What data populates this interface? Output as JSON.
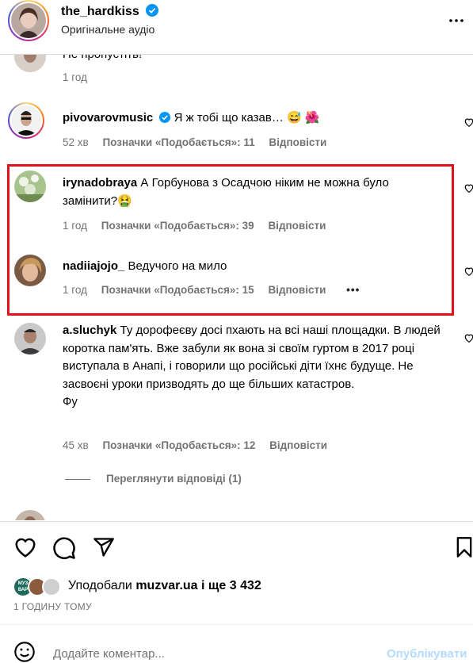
{
  "header": {
    "username": "the_hardkiss",
    "audio": "Оригінальне аудіо"
  },
  "comments": [
    {
      "user": "",
      "text": "Не пропустіть!",
      "time": "1 год",
      "likes": "",
      "reply": ""
    },
    {
      "user": "pivovarovmusic",
      "text": "Я ж тобі що казав… 😅 🌺",
      "time": "52 хв",
      "likes": "Позначки «Подобається»: 11",
      "reply": "Відповісти"
    },
    {
      "user": "irynadobraya",
      "text": "А Горбунова з Осадчою ніким не можна було замінити?🤮",
      "time": "1 год",
      "likes": "Позначки «Подобається»: 39",
      "reply": "Відповісти"
    },
    {
      "user": "nadiiajojo_",
      "text": "Ведучого на мило",
      "time": "1 год",
      "likes": "Позначки «Подобається»: 15",
      "reply": "Відповісти"
    },
    {
      "user": "a.sluchyk",
      "text": "Ту дорофеєву досі пхають на всі наші площадки. В людей коротка пам'ять. Вже забули як вона зі своїм гуртом в 2017 році виступала в Анапі, і говорили що російські діти їхнє будуще. Не засвоєні уроки призводять до ще більших катастров.",
      "text2": "Фу",
      "time": "45 хв",
      "likes": "Позначки «Подобається»: 12",
      "reply": "Відповісти"
    }
  ],
  "view_replies": "Переглянути відповіді (1)",
  "partial_comment": {
    "user": "",
    "text": ""
  },
  "likes": {
    "prefix": "Уподобали",
    "user": "muzvar.ua",
    "suffix": "і ще 3 432"
  },
  "time_ago": "1 ГОДИНУ ТОМУ",
  "add_comment": {
    "placeholder": "Додайте коментар...",
    "post": "Опублікувати"
  },
  "muzvar_badge": "МУЗ ВАР",
  "colors": {
    "highlight": "#e4111b",
    "verified": "#0095f6",
    "muted": "#737373"
  }
}
